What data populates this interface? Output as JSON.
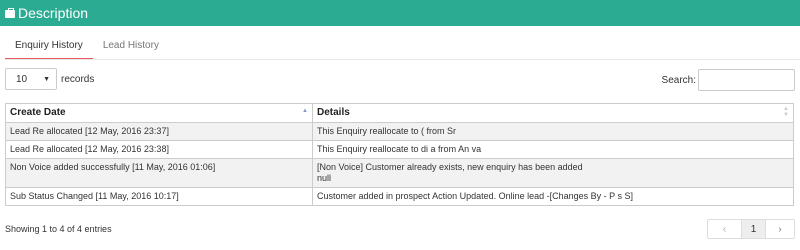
{
  "panel": {
    "title": "Description",
    "icon": "briefcase-icon"
  },
  "tabs": [
    {
      "label": "Enquiry History",
      "active": true
    },
    {
      "label": "Lead History",
      "active": false
    }
  ],
  "length": {
    "value": "10",
    "label": "records"
  },
  "search": {
    "label": "Search:",
    "value": ""
  },
  "table": {
    "columns": [
      "Create Date",
      "Details"
    ],
    "rows": [
      {
        "date": "Lead Re allocated [12 May, 2016 23:37]",
        "details": "This Enquiry reallocate to (          from          Sr",
        "details2": ""
      },
      {
        "date": "Lead Re allocated [12 May, 2016 23:38]",
        "details": "This Enquiry reallocate to di          a from An          va",
        "details2": ""
      },
      {
        "date": "Non Voice added successfully [11 May, 2016 01:06]",
        "details": "[Non Voice] Customer already exists, new enquiry has been added",
        "details2": "null"
      },
      {
        "date": "Sub Status Changed [11 May, 2016 10:17]",
        "details": "Customer added in prospect Action Updated. Online lead -[Changes By - P     s S]",
        "details2": ""
      }
    ]
  },
  "info": "Showing 1 to 4 of 4 entries",
  "pagination": {
    "prev": "‹",
    "current": "1",
    "next": "›"
  },
  "colors": {
    "header": "#2cab93",
    "active_tab": "#e9545d",
    "striped_row": "#f2f2f2"
  }
}
